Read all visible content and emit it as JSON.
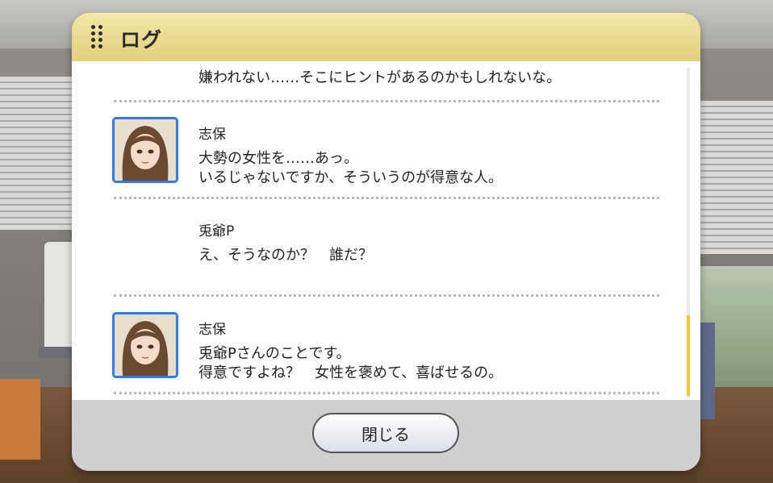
{
  "panel": {
    "title": "ログ"
  },
  "entries": [
    {
      "lines": [
        "嫌われない……そこにヒントがあるのかもしれないな。"
      ]
    },
    {
      "speaker": "志保",
      "has_avatar": true,
      "lines": [
        "大勢の女性を……あっ。",
        "いるじゃないですか、そういうのが得意な人。"
      ]
    },
    {
      "speaker": "兎爺P",
      "has_avatar": false,
      "lines": [
        "え、そうなのか？　誰だ？"
      ]
    },
    {
      "speaker": "志保",
      "has_avatar": true,
      "lines": [
        "兎爺Pさんのことです。",
        "得意ですよね？　女性を褒めて、喜ばせるの。"
      ]
    }
  ],
  "footer": {
    "close_label": "閉じる"
  },
  "colors": {
    "header": "#e8d88c",
    "avatar_border": "#2f7de0",
    "scroll_thumb": "#f0c93a"
  }
}
